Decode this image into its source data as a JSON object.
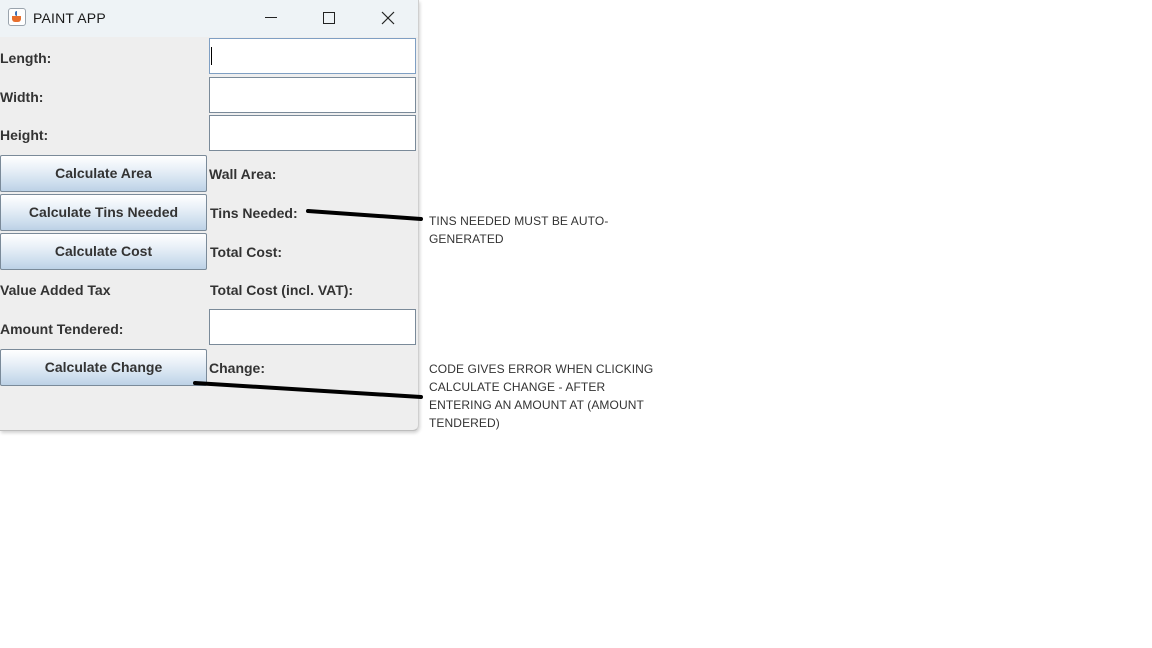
{
  "window": {
    "title": "PAINT APP",
    "controls": {
      "minimize": "minimize",
      "maximize": "maximize",
      "close": "close"
    }
  },
  "form": {
    "length_label": "Length:",
    "length_value": "",
    "width_label": "Width:",
    "width_value": "",
    "height_label": "Height:",
    "height_value": "",
    "calc_area_button": "Calculate Area",
    "wall_area_label": "Wall Area:",
    "calc_tins_button": "Calculate Tins Needed",
    "tins_needed_label": "Tins Needed:",
    "calc_cost_button": "Calculate Cost",
    "total_cost_label": "Total Cost:",
    "vat_label": "Value Added Tax",
    "total_cost_vat_label": "Total Cost (incl. VAT):",
    "amount_tendered_label": "Amount Tendered:",
    "amount_tendered_value": "",
    "calc_change_button": "Calculate Change",
    "change_label": "Change:"
  },
  "annotations": [
    {
      "text": "TINS NEEDED MUST BE AUTO-GENERATED"
    },
    {
      "text": "CODE GIVES ERROR WHEN CLICKING CALCULATE CHANGE - AFTER ENTERING AN AMOUNT AT (AMOUNT TENDERED)"
    }
  ],
  "colors": {
    "window_bg": "#eeeeee",
    "titlebar_bg": "#eef3f6",
    "button_gradient_bottom": "#bcd1e6",
    "label_text": "#333333",
    "annotation_line": "#000000"
  },
  "icons": {
    "app": "java-cup-icon",
    "minimize": "minimize-icon",
    "maximize": "maximize-icon",
    "close": "close-icon"
  }
}
